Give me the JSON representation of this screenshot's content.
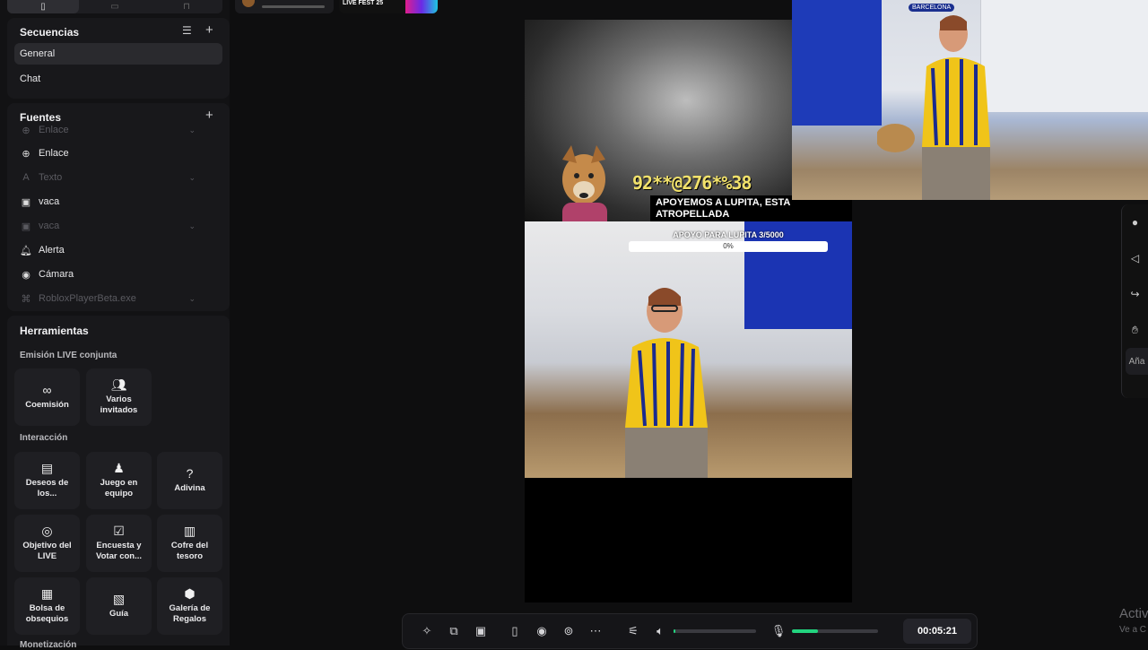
{
  "topbar": {
    "mode_tabs": [
      "mobile-icon",
      "window-icon",
      "lock-icon"
    ],
    "live_fest": "LIVE FEST 25"
  },
  "secuencias": {
    "title": "Secuencias",
    "items": [
      {
        "label": "General",
        "selected": true
      },
      {
        "label": "Chat",
        "selected": false
      }
    ]
  },
  "fuentes": {
    "title": "Fuentes",
    "items": [
      {
        "label": "Enlace",
        "icon": "globe-icon",
        "dim": true,
        "chevron": true
      },
      {
        "label": "Enlace",
        "icon": "globe-icon",
        "dim": false,
        "chevron": false
      },
      {
        "label": "Texto",
        "icon": "text-icon",
        "dim": true,
        "chevron": true
      },
      {
        "label": "vaca",
        "icon": "image-icon",
        "dim": false,
        "chevron": false
      },
      {
        "label": "vaca",
        "icon": "image-icon",
        "dim": true,
        "chevron": true
      },
      {
        "label": "Alerta",
        "icon": "bell-icon",
        "dim": false,
        "chevron": false
      },
      {
        "label": "Cámara",
        "icon": "camera-icon",
        "dim": false,
        "chevron": false
      },
      {
        "label": "RobloxPlayerBeta.exe",
        "icon": "gamepad-icon",
        "dim": true,
        "chevron": true
      }
    ]
  },
  "herramientas": {
    "title": "Herramientas",
    "emision_title": "Emisión LIVE conjunta",
    "emision": [
      {
        "label": "Coemisión",
        "icon": "link-icon"
      },
      {
        "label": "Varios invitados",
        "icon": "users-icon"
      }
    ],
    "interaccion_title": "Interacción",
    "interaccion": [
      {
        "label": "Deseos de los...",
        "icon": "wishes-icon"
      },
      {
        "label": "Juego en equipo",
        "icon": "team-icon"
      },
      {
        "label": "Adivina",
        "icon": "guess-icon"
      },
      {
        "label": "Objetivo del LIVE",
        "icon": "target-icon"
      },
      {
        "label": "Encuesta y Votar con...",
        "icon": "poll-icon"
      },
      {
        "label": "Cofre del tesoro",
        "icon": "chest-icon"
      },
      {
        "label": "Bolsa de obsequios",
        "icon": "gift-bag-icon"
      },
      {
        "label": "Guía",
        "icon": "guide-icon"
      },
      {
        "label": "Galería de Regalos",
        "icon": "gallery-icon"
      }
    ],
    "monetizacion_title": "Monetización"
  },
  "canvas": {
    "ticker": "92**@276*%38",
    "banner": "APOYEMOS A LUPITA, ESTA ATROPELLADA",
    "goal_label": "APOYO PARA LUPITA 3/5000",
    "goal_percent": "0%",
    "goal_progress": 0.0006,
    "side_sign": "BARCELONA"
  },
  "bottombar": {
    "icons": [
      "magic-wand-icon",
      "layers-icon",
      "screen-icon",
      "phone-icon",
      "record-icon",
      "effects-icon",
      "more-icon",
      "settings-sliders-icon",
      "volume-icon",
      "mic-icon"
    ],
    "volume_level": 0.02,
    "mic_level": 0.3,
    "timer": "00:05:21"
  },
  "right_tools": {
    "icons": [
      "avatar-icon",
      "megaphone-icon",
      "share-icon",
      "hand-icon"
    ],
    "add_label": "Aña"
  },
  "watermark": {
    "line1": "Activ",
    "line2": "Ve a C"
  }
}
